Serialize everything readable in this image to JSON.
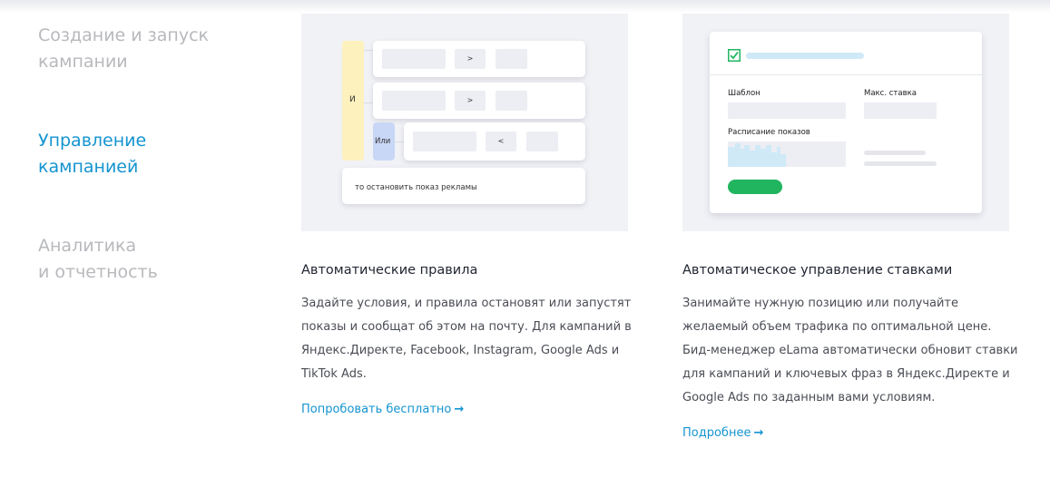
{
  "nav": {
    "items": [
      {
        "label": "Создание и запуск\nкампании",
        "active": false
      },
      {
        "label": "Управление\nкампанией",
        "active": true
      },
      {
        "label": "Аналитика\nи отчетность",
        "active": false
      }
    ]
  },
  "cards": [
    {
      "title": "Автоматические правила",
      "text": "Задайте условия, и правила остановят или запустят показы и сообщат об этом на почту. Для кампаний в Яндекс.Директе, Facebook, Instagram, Google Ads и TikTok Ads.",
      "link": "Попробовать бесплатно",
      "link_icon": "arrow-right-icon",
      "illustration": {
        "and_label": "И",
        "or_label": "Или",
        "ops": [
          ">",
          ">",
          "<"
        ],
        "action_text": "то остановить показ рекламы"
      }
    },
    {
      "title": "Автоматическое управление ставками",
      "text": "Занимайте нужную позицию или получайте желаемый объем трафика по оптимальной цене. Бид-менеджер eLama автоматически обновит ставки для кампаний и ключевых фраз в Яндекс.Директе и Google Ads по заданным вами условиям.",
      "link": "Подробнее",
      "link_icon": "arrow-right-icon",
      "illustration": {
        "template_label": "Шаблон",
        "max_bid_label": "Макс. ставка",
        "schedule_label": "Расписание показов",
        "check_icon": "checkbox-checked-icon"
      }
    }
  ],
  "colors": {
    "accent": "#1594d0",
    "nav_inactive": "#b8b9bd",
    "green": "#22b560",
    "yellow": "#fdf1be",
    "lavender": "#c9d7f7"
  }
}
